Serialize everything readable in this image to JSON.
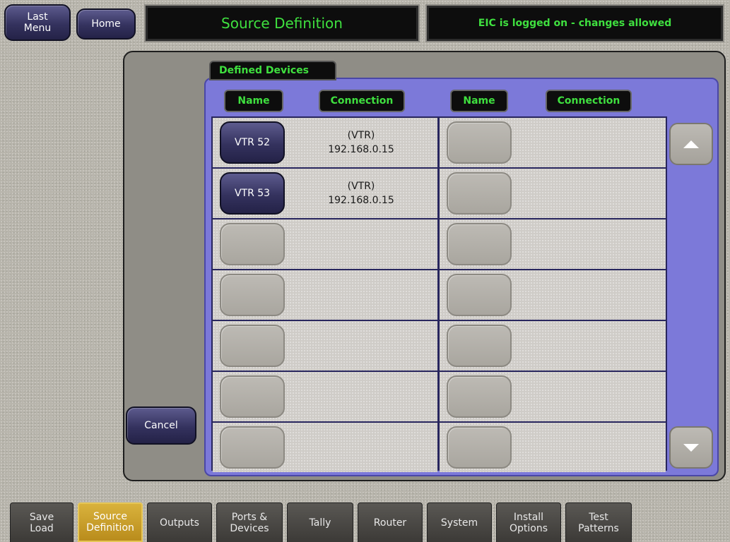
{
  "header": {
    "last_menu_label": "Last\nMenu",
    "home_label": "Home",
    "title": "Source Definition",
    "status": "EIC is logged on - changes allowed"
  },
  "panel": {
    "tab_title": "Defined Devices",
    "col_headers": [
      "Name",
      "Connection",
      "Name",
      "Connection"
    ],
    "cancel_label": "Cancel",
    "left_rows": [
      {
        "name": "VTR 52",
        "conn_type": "(VTR)",
        "conn_ip": "192.168.0.15"
      },
      {
        "name": "VTR 53",
        "conn_type": "(VTR)",
        "conn_ip": "192.168.0.15"
      },
      {
        "name": "",
        "conn_type": "",
        "conn_ip": ""
      },
      {
        "name": "",
        "conn_type": "",
        "conn_ip": ""
      },
      {
        "name": "",
        "conn_type": "",
        "conn_ip": ""
      },
      {
        "name": "",
        "conn_type": "",
        "conn_ip": ""
      },
      {
        "name": "",
        "conn_type": "",
        "conn_ip": ""
      }
    ],
    "right_rows": [
      {
        "name": "",
        "conn_type": "",
        "conn_ip": ""
      },
      {
        "name": "",
        "conn_type": "",
        "conn_ip": ""
      },
      {
        "name": "",
        "conn_type": "",
        "conn_ip": ""
      },
      {
        "name": "",
        "conn_type": "",
        "conn_ip": ""
      },
      {
        "name": "",
        "conn_type": "",
        "conn_ip": ""
      },
      {
        "name": "",
        "conn_type": "",
        "conn_ip": ""
      },
      {
        "name": "",
        "conn_type": "",
        "conn_ip": ""
      }
    ],
    "scroll_up_icon": "triangle-up-icon",
    "scroll_down_icon": "triangle-down-icon"
  },
  "bottom_tabs": [
    {
      "label": "Save\nLoad",
      "active": false
    },
    {
      "label": "Source\nDefinition",
      "active": true
    },
    {
      "label": "Outputs",
      "active": false
    },
    {
      "label": "Ports &\nDevices",
      "active": false
    },
    {
      "label": "Tally",
      "active": false
    },
    {
      "label": "Router",
      "active": false
    },
    {
      "label": "System",
      "active": false
    },
    {
      "label": "Install\nOptions",
      "active": false
    },
    {
      "label": "Test\nPatterns",
      "active": false
    }
  ],
  "colors": {
    "accent_green": "#3fe03f",
    "panel_blue": "#7c79d9",
    "active_tab_gold": "#c99f2a",
    "button_navy": "#34325e"
  }
}
